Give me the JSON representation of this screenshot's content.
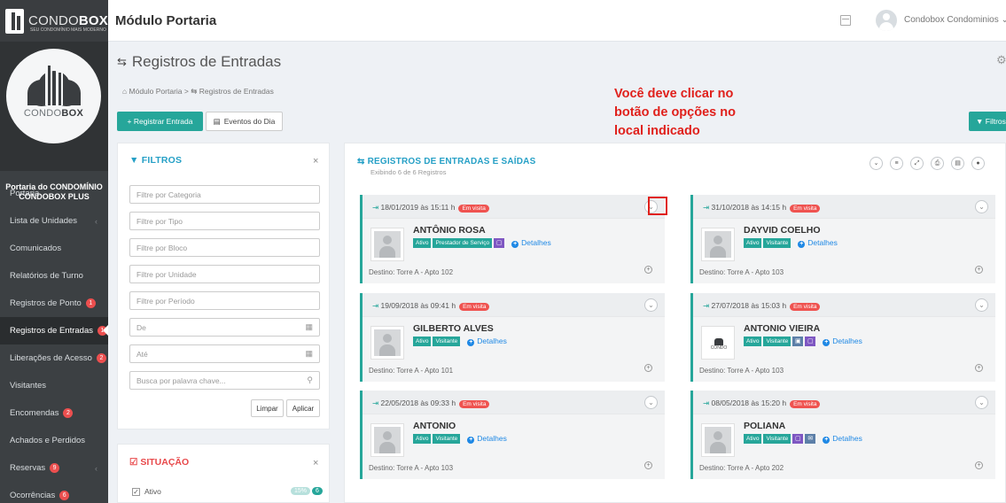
{
  "brand": {
    "name_light": "CONDO",
    "name_bold": "BOX",
    "tagline": "SEU CONDOMÍNIO MAIS MODERNO",
    "avatar_light": "CONDO",
    "avatar_bold": "BOX"
  },
  "sidebar": {
    "portaria_name": "Portaria do CONDOMÍNIO CONDOBOX PLUS",
    "items": [
      {
        "label": "Portaria",
        "badge": "",
        "chevron": ""
      },
      {
        "label": "Lista de Unidades",
        "badge": "",
        "chevron": "‹"
      },
      {
        "label": "Comunicados",
        "badge": "",
        "chevron": ""
      },
      {
        "label": "Relatórios de Turno",
        "badge": "",
        "chevron": ""
      },
      {
        "label": "Registros de Ponto",
        "badge": "1",
        "chevron": ""
      },
      {
        "label": "Registros de Entradas",
        "badge": "1",
        "chevron": ""
      },
      {
        "label": "Liberações de Acesso",
        "badge": "2",
        "chevron": ""
      },
      {
        "label": "Visitantes",
        "badge": "",
        "chevron": ""
      },
      {
        "label": "Encomendas",
        "badge": "2",
        "chevron": ""
      },
      {
        "label": "Achados e Perdidos",
        "badge": "",
        "chevron": ""
      },
      {
        "label": "Reservas",
        "badge": "9",
        "chevron": "‹"
      },
      {
        "label": "Ocorrências",
        "badge": "6",
        "chevron": ""
      }
    ]
  },
  "topbar": {
    "module_title": "Módulo Portaria",
    "user_name": "Condobox Condominios ⌄"
  },
  "page": {
    "title": "Registros de Entradas",
    "breadcrumb_home": "Módulo Portaria",
    "breadcrumb_sep": ">",
    "breadcrumb_current": "Registros de Entradas"
  },
  "actions": {
    "registrar": "+ Registrar Entrada",
    "eventos": "Eventos do Dia",
    "filtros": "▼ Filtros"
  },
  "annotation": {
    "text": "Você deve clicar no botão de opções no local indicado abaixo"
  },
  "filters": {
    "title": "FILTROS",
    "close": "×",
    "fields": [
      {
        "placeholder": "Filtre por Categoria",
        "suffix": ""
      },
      {
        "placeholder": "Filtre por Tipo",
        "suffix": ""
      },
      {
        "placeholder": "Filtre por Bloco",
        "suffix": ""
      },
      {
        "placeholder": "Filtre por Unidade",
        "suffix": ""
      },
      {
        "placeholder": "Filtre por Período",
        "suffix": ""
      },
      {
        "placeholder": "De",
        "suffix": "▦"
      },
      {
        "placeholder": "Até",
        "suffix": "▦"
      },
      {
        "placeholder": "Busca por palavra chave...",
        "suffix": "⚲"
      }
    ],
    "limpar": "Limpar",
    "aplicar": "Aplicar"
  },
  "situacao": {
    "title": "SITUAÇÃO",
    "close": "×",
    "item": "Ativo",
    "count_a": "15%",
    "count_b": "6"
  },
  "records": {
    "title": "REGISTROS DE ENTRADAS E SAÍDAS",
    "subtitle": "Exibindo 6 de 6 Registros",
    "tools": [
      "⌄",
      "≡",
      "⤢",
      "⎙",
      "▤",
      "●"
    ],
    "details_label": "Detalhes",
    "cards": [
      {
        "date": "18/01/2019 às 15:11 h",
        "status": "Em visita",
        "name": "ANTÔNIO ROSA",
        "tags": [
          "Ativo",
          "Prestador de Serviço"
        ],
        "icons": [
          "▢"
        ],
        "dest": "Destino: Torre A - Apto 102",
        "logo": false
      },
      {
        "date": "31/10/2018 às 14:15 h",
        "status": "Em visita",
        "name": "DAYVID COELHO",
        "tags": [
          "Ativo",
          "Visitante"
        ],
        "icons": [],
        "dest": "Destino: Torre A - Apto 103",
        "logo": false
      },
      {
        "date": "19/09/2018 às 09:41 h",
        "status": "Em visita",
        "name": "GILBERTO ALVES",
        "tags": [
          "Ativo",
          "Visitante"
        ],
        "icons": [],
        "dest": "Destino: Torre A - Apto 101",
        "logo": false
      },
      {
        "date": "27/07/2018 às 15:03 h",
        "status": "Em visita",
        "name": "ANTONIO VIEIRA",
        "tags": [
          "Ativo",
          "Visitante"
        ],
        "icons": [
          "▣",
          "▢"
        ],
        "dest": "Destino: Torre A - Apto 103",
        "logo": true
      },
      {
        "date": "22/05/2018 às 09:33 h",
        "status": "Em visita",
        "name": "ANTONIO",
        "tags": [
          "Ativo",
          "Visitante"
        ],
        "icons": [],
        "dest": "Destino: Torre A - Apto 103",
        "logo": false
      },
      {
        "date": "08/05/2018 às 15:20 h",
        "status": "Em visita",
        "name": "POLIANA",
        "tags": [
          "Ativo",
          "Visitante"
        ],
        "icons": [
          "▢",
          "✉"
        ],
        "dest": "Destino: Torre A - Apto 202",
        "logo": false
      }
    ]
  },
  "colors": {
    "accent": "#26a69a",
    "title_blue": "#26a0c6",
    "danger": "#ef5350",
    "sidebar": "#3c4043"
  }
}
